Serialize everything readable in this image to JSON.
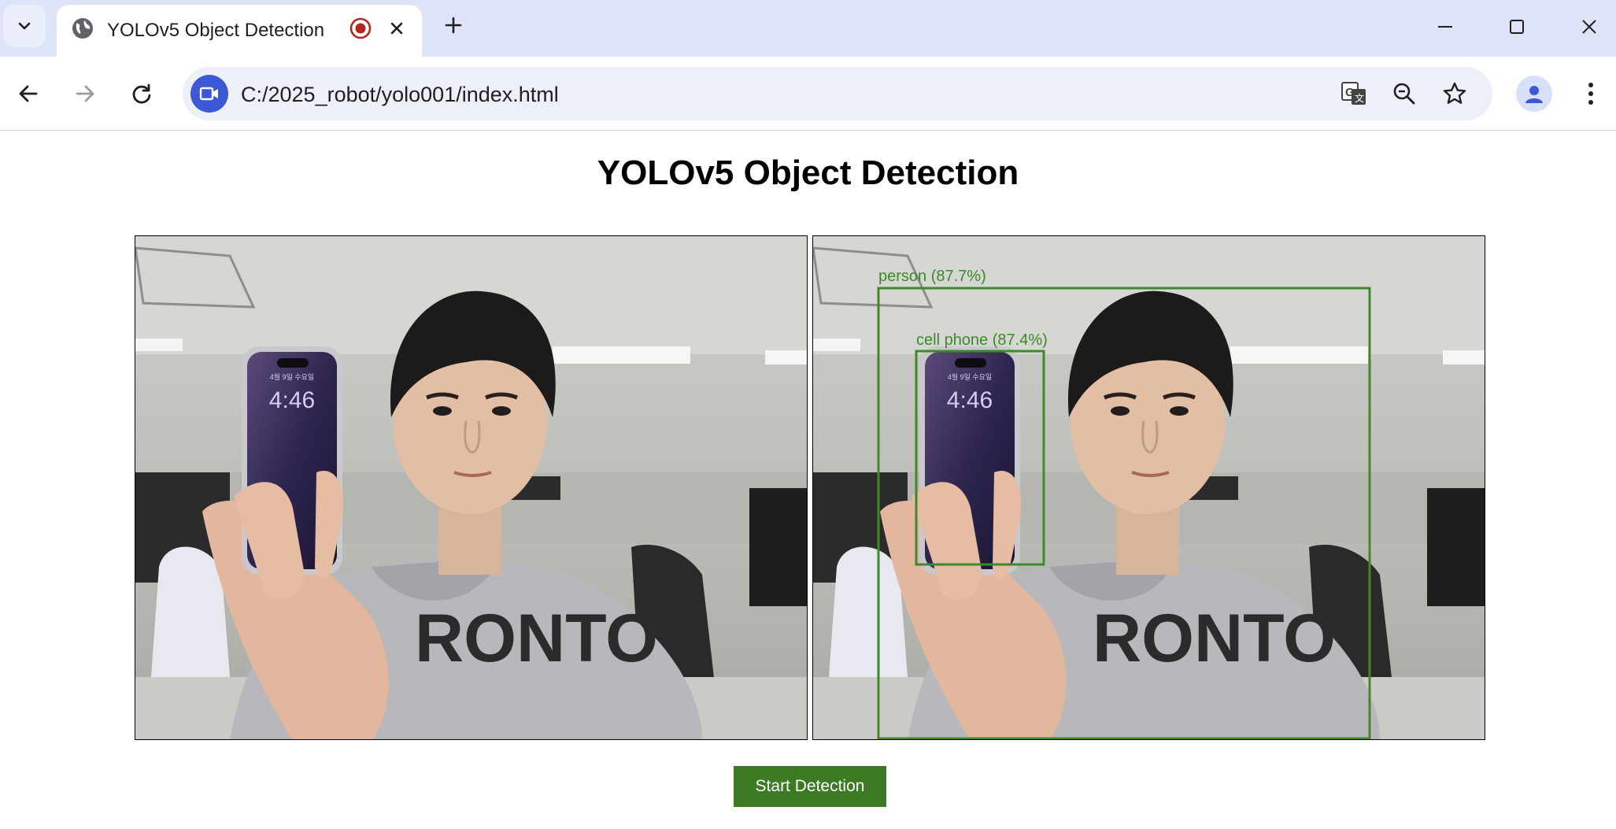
{
  "browser": {
    "tab_title": "YOLOv5 Object Detection",
    "url": "C:/2025_robot/yolo001/index.html"
  },
  "page": {
    "title": "YOLOv5 Object Detection",
    "start_button_label": "Start Detection"
  },
  "detections": [
    {
      "label": "person (87.7%)",
      "color": "#3c8a2a"
    },
    {
      "label": "cell phone (87.4%)",
      "color": "#3c8a2a"
    }
  ],
  "phone_screen": {
    "time": "4:46"
  },
  "colors": {
    "tabstrip": "#dfe3f7",
    "accent_button": "#3c7a23",
    "box_color": "#3c8a2a"
  }
}
